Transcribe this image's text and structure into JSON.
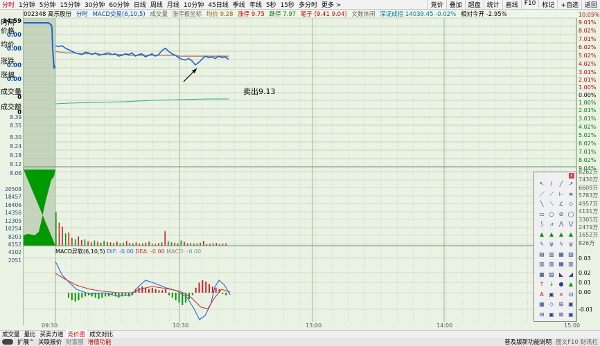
{
  "toolbar": {
    "tabs": [
      "分时",
      "1分钟",
      "5分钟",
      "15分钟",
      "30分钟",
      "60分钟",
      "日线",
      "周线",
      "月线",
      "10分钟",
      "45日线",
      "季线",
      "年线",
      "5秒",
      "15秒",
      "多分时",
      "更多 >"
    ],
    "right": [
      "竞价",
      "叠加",
      "超盘",
      "统计",
      "画线",
      "F10",
      "标记",
      "+自选",
      "返回"
    ]
  },
  "infobar": {
    "code": "002348 高乐股份",
    "mode": "分时",
    "indicator": "MACD交易(6,10,5)",
    "vol": "成交量",
    "board": "涨停板坐标",
    "avg": "均价 9.28",
    "up": "涨停 9.75",
    "down": "跌停 7.97",
    "pen": "笔子 (9.41 9.04)",
    "bull": "文数体闲",
    "index": "深证成指 14039.45 -0.02%",
    "rel": "相对今开 -2.95%"
  },
  "left_panel": {
    "time_label": "时间",
    "time_value": "14:59",
    "price_label": "价格",
    "price_value": "0.00",
    "avg_label": "均价",
    "avg_value": "0.00",
    "chg_label": "涨跌",
    "chg_value": "0.00",
    "pct_label": "涨幅",
    "pct_value": "0.00",
    "volume_label": "成交量",
    "volume_value": "0",
    "amount_label": "成交额",
    "amount_value": "0"
  },
  "price_ticks_left": [
    "8.39",
    "8.35",
    "8.30",
    "8.24",
    "8.18",
    "8.12",
    "8.06"
  ],
  "volume_ticks_left": [
    "20508",
    "18457",
    "16406",
    "14356",
    "12305",
    "10254",
    "8203",
    "6152",
    "4102",
    "2051"
  ],
  "right_pct_ticks": [
    "10.05%",
    "9.01%",
    "8.02%",
    "7.01%",
    "6.02%",
    "5.02%",
    "4.02%",
    "3.01%",
    "2.01%",
    "1.00%",
    "0.00%",
    "1.00%",
    "2.01%",
    "3.01%",
    "4.02%",
    "5.02%",
    "6.02%",
    "7.01%",
    "8.02%",
    "9.04%"
  ],
  "right_vol_ticks": [
    "8262万",
    "7436万",
    "6609万",
    "5783万",
    "4957万",
    "4131万",
    "3305万",
    "2479万",
    "1652万",
    "826万"
  ],
  "right_macd_ticks": [
    "0.03",
    "0.02",
    "0.01",
    "0.00",
    "-0.01"
  ],
  "annotation": "卖出9.13",
  "macd_label": {
    "name": "MACD异软(6,10,5)",
    "dif": "DIF: -0.00",
    "dea": "DEA: -0.00",
    "macd": "MACD: -0.00"
  },
  "time_axis": [
    "09:30",
    "10:30",
    "13:00",
    "14:00",
    "15:00"
  ],
  "bottom_tabs": [
    "成交量",
    "量比",
    "买卖力道",
    "竞价图",
    "成交对比"
  ],
  "status_left": [
    "扩展^",
    "关联报价",
    "财富圈",
    "增值功能"
  ],
  "status_right": [
    "普及版新功能说明",
    "图文F10 财讯栏"
  ],
  "chart_data": {
    "type": "line",
    "title": "",
    "series": [
      {
        "name": "价格",
        "values_pct": [
          5.9,
          5.8,
          5.9,
          5.6,
          5.4,
          5.2,
          5.0,
          4.9,
          4.8,
          5.1,
          5.0,
          4.8,
          5.0,
          4.7,
          4.8,
          4.9,
          5.0,
          4.8,
          4.9,
          4.6,
          4.7,
          4.9,
          4.8,
          5.0,
          4.6,
          4.8,
          4.9,
          4.5,
          4.7,
          4.9,
          4.6,
          4.8,
          5.3,
          5.6,
          5.2,
          4.9,
          4.7,
          4.4,
          4.2,
          4.1,
          4.3,
          4.0,
          3.5,
          3.8,
          4.2,
          4.6,
          4.4,
          4.5,
          4.3,
          4.6,
          4.4,
          4.5,
          4.2
        ]
      },
      {
        "name": "均价",
        "values_pct": [
          5.2,
          5.1,
          5.1,
          5.0,
          5.0,
          5.0,
          5.0,
          4.9,
          4.9,
          4.9,
          4.9,
          4.9,
          4.9,
          4.9,
          4.8,
          4.8,
          4.8,
          4.8,
          4.8,
          4.8,
          4.8,
          4.8,
          4.7,
          4.7,
          4.7,
          4.7,
          4.7,
          4.7,
          4.7,
          4.7,
          4.7,
          4.7,
          4.7,
          4.7,
          4.7,
          4.7,
          4.7,
          4.6,
          4.6,
          4.6,
          4.6,
          4.6,
          4.6,
          4.6,
          4.6,
          4.6,
          4.6,
          4.6,
          4.6,
          4.6,
          4.6,
          4.6,
          4.6
        ]
      }
    ],
    "auction_volume_max": 20508,
    "volume_bars": [
      9000,
      6200,
      5100,
      3300,
      3600,
      2100,
      1700,
      2500,
      1500,
      1700,
      1200,
      900,
      1400,
      1100,
      800,
      1300,
      1000,
      900,
      700,
      1100,
      600,
      800,
      1300,
      700,
      600,
      900,
      500,
      600,
      800,
      1100,
      500,
      400,
      700,
      900,
      3900,
      1200,
      900,
      800,
      600,
      1400,
      1000,
      600,
      700,
      500,
      600,
      800,
      1300,
      400,
      500,
      600,
      700,
      400,
      500,
      600
    ],
    "macd_bars": [
      -0.004,
      -0.006,
      -0.007,
      -0.006,
      -0.004,
      -0.003,
      -0.002,
      -0.003,
      -0.004,
      -0.005,
      -0.004,
      -0.003,
      -0.003,
      -0.002,
      -0.003,
      -0.004,
      -0.003,
      -0.002,
      -0.003,
      -0.002,
      0.003,
      0.004,
      0.005,
      0.004,
      0.003,
      0.004,
      0.003,
      0.002,
      0.002,
      0.003,
      -0.002,
      -0.004,
      -0.006,
      -0.008,
      -0.01,
      -0.008,
      -0.005,
      -0.002,
      0.004,
      0.008,
      0.01,
      0.009,
      0.007,
      0.005,
      0.004,
      0.003,
      -0.001,
      -0.002
    ],
    "ylim_pct": [
      -9.04,
      10.05
    ]
  }
}
